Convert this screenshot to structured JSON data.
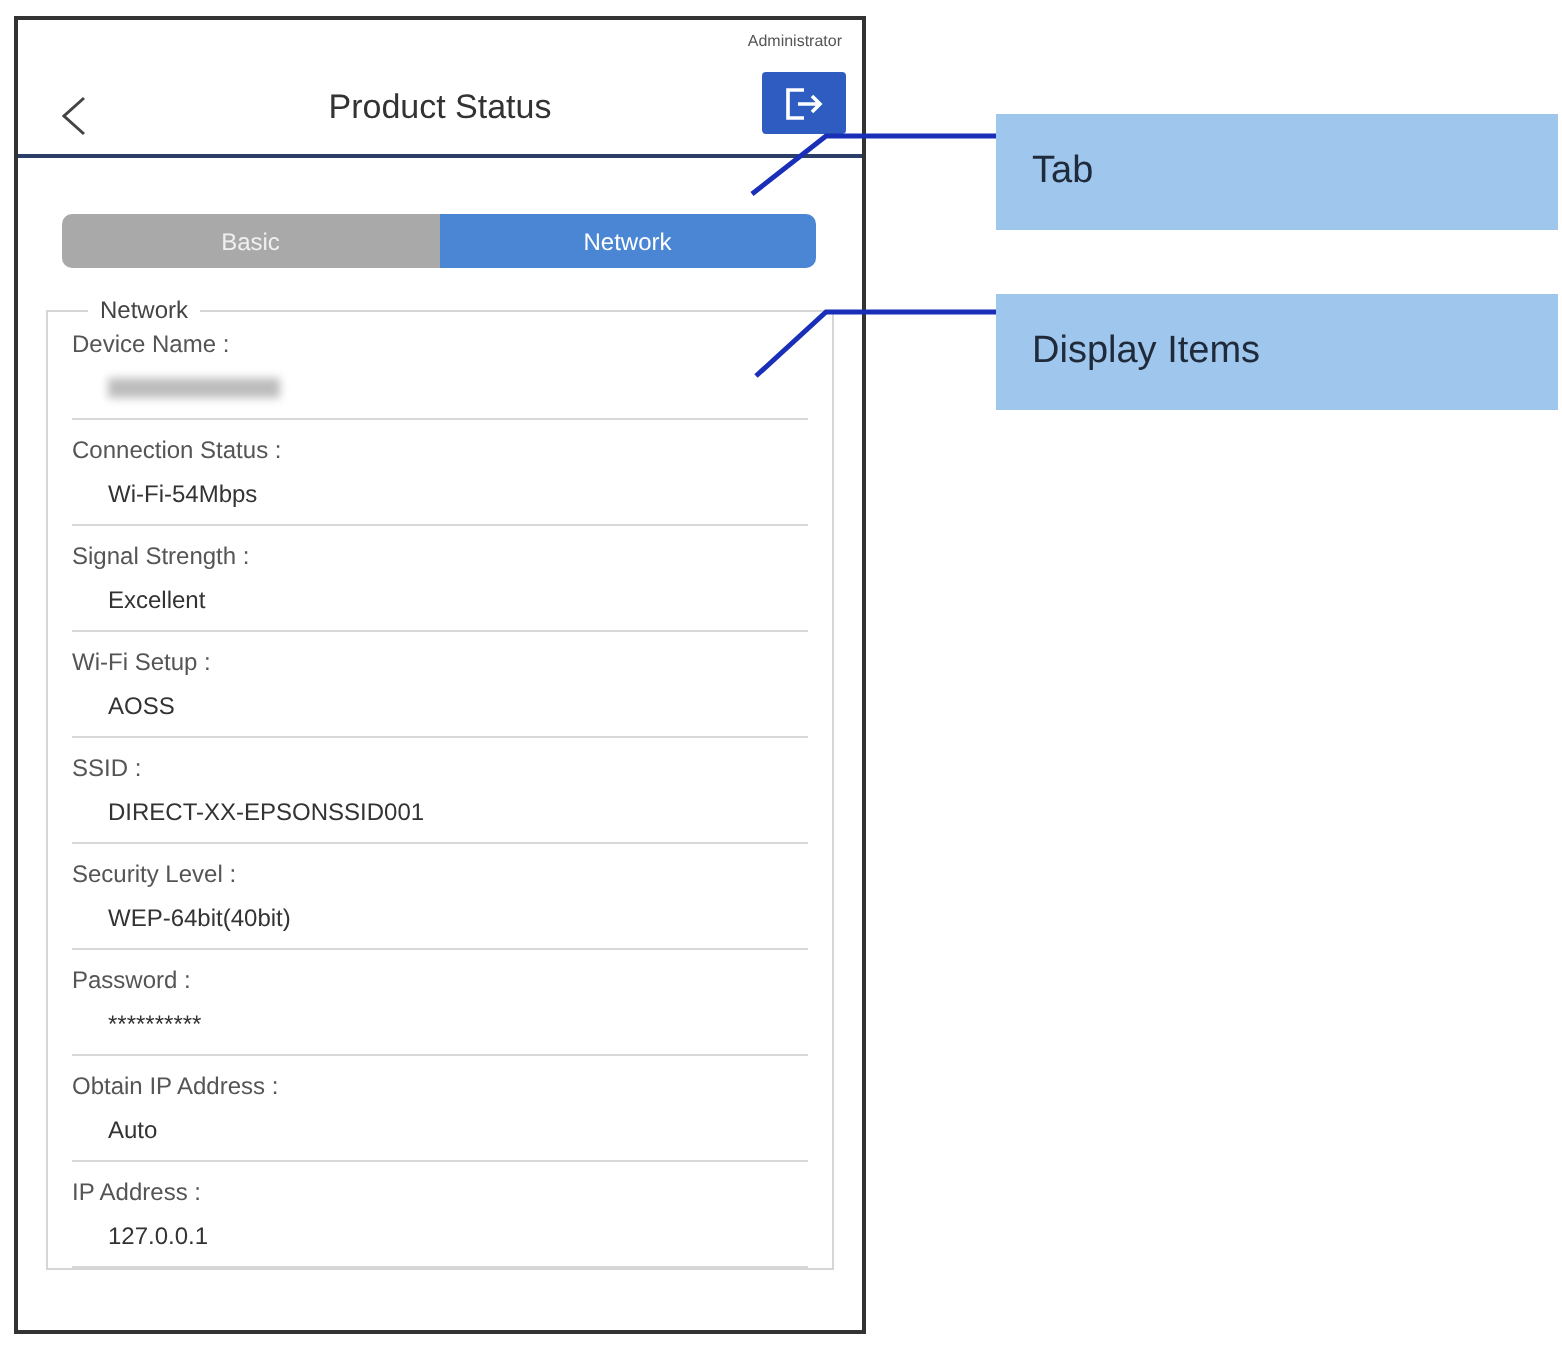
{
  "header": {
    "account": "Administrator",
    "title": "Product Status"
  },
  "tabs": [
    {
      "label": "Basic",
      "selected": false
    },
    {
      "label": "Network",
      "selected": true
    }
  ],
  "section": {
    "legend": "Network",
    "items": [
      {
        "label": "Device Name :",
        "kind": "redacted"
      },
      {
        "label": "Connection Status :",
        "kind": "text",
        "value": "Wi-Fi-54Mbps"
      },
      {
        "label": "Signal Strength :",
        "kind": "text",
        "value": "Excellent"
      },
      {
        "label": "Wi-Fi Setup :",
        "kind": "text",
        "value": "AOSS"
      },
      {
        "label": "SSID :",
        "kind": "text",
        "value": "DIRECT-XX-EPSONSSID001"
      },
      {
        "label": "Security Level :",
        "kind": "text",
        "value": "WEP-64bit(40bit)"
      },
      {
        "label": "Password :",
        "kind": "text",
        "value": "**********"
      },
      {
        "label": "Obtain IP Address :",
        "kind": "text",
        "value": "Auto"
      },
      {
        "label": "IP Address :",
        "kind": "text",
        "value": "127.0.0.1"
      }
    ]
  },
  "callouts": [
    {
      "label": "Tab"
    },
    {
      "label": "Display Items"
    }
  ]
}
